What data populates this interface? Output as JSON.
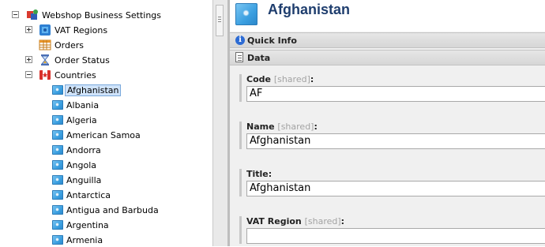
{
  "tree": {
    "root": {
      "label": "Webshop Business Settings",
      "icon": "webshop-settings-icon"
    },
    "items": [
      {
        "label": "VAT Regions",
        "icon": "vat-regions-icon",
        "expanded": false
      },
      {
        "label": "Orders",
        "icon": "orders-grid-icon"
      },
      {
        "label": "Order Status",
        "icon": "hourglass-icon",
        "expanded": false
      },
      {
        "label": "Countries",
        "icon": "countries-icon",
        "expanded": true
      }
    ],
    "countries": [
      "Afghanistan",
      "Albania",
      "Algeria",
      "American Samoa",
      "Andorra",
      "Angola",
      "Anguilla",
      "Antarctica",
      "Antigua and Barbuda",
      "Argentina",
      "Armenia"
    ],
    "selected": "Afghanistan"
  },
  "editor": {
    "title": "Afghanistan",
    "sections": {
      "quick_info": "Quick Info",
      "data": "Data"
    },
    "fields": [
      {
        "label": "Code",
        "shared": "[shared]",
        "colon": ":",
        "value": "AF"
      },
      {
        "label": "Name",
        "shared": "[shared]",
        "colon": ":",
        "value": "Afghanistan"
      },
      {
        "label": "Title",
        "shared": "",
        "colon": ":",
        "value": "Afghanistan"
      },
      {
        "label": "VAT Region",
        "shared": "[shared]",
        "colon": ":",
        "value": ""
      }
    ]
  },
  "colors": {
    "title": "#1f3e6e",
    "selection": "#cfe3fa",
    "info": "#2c6bd4"
  }
}
